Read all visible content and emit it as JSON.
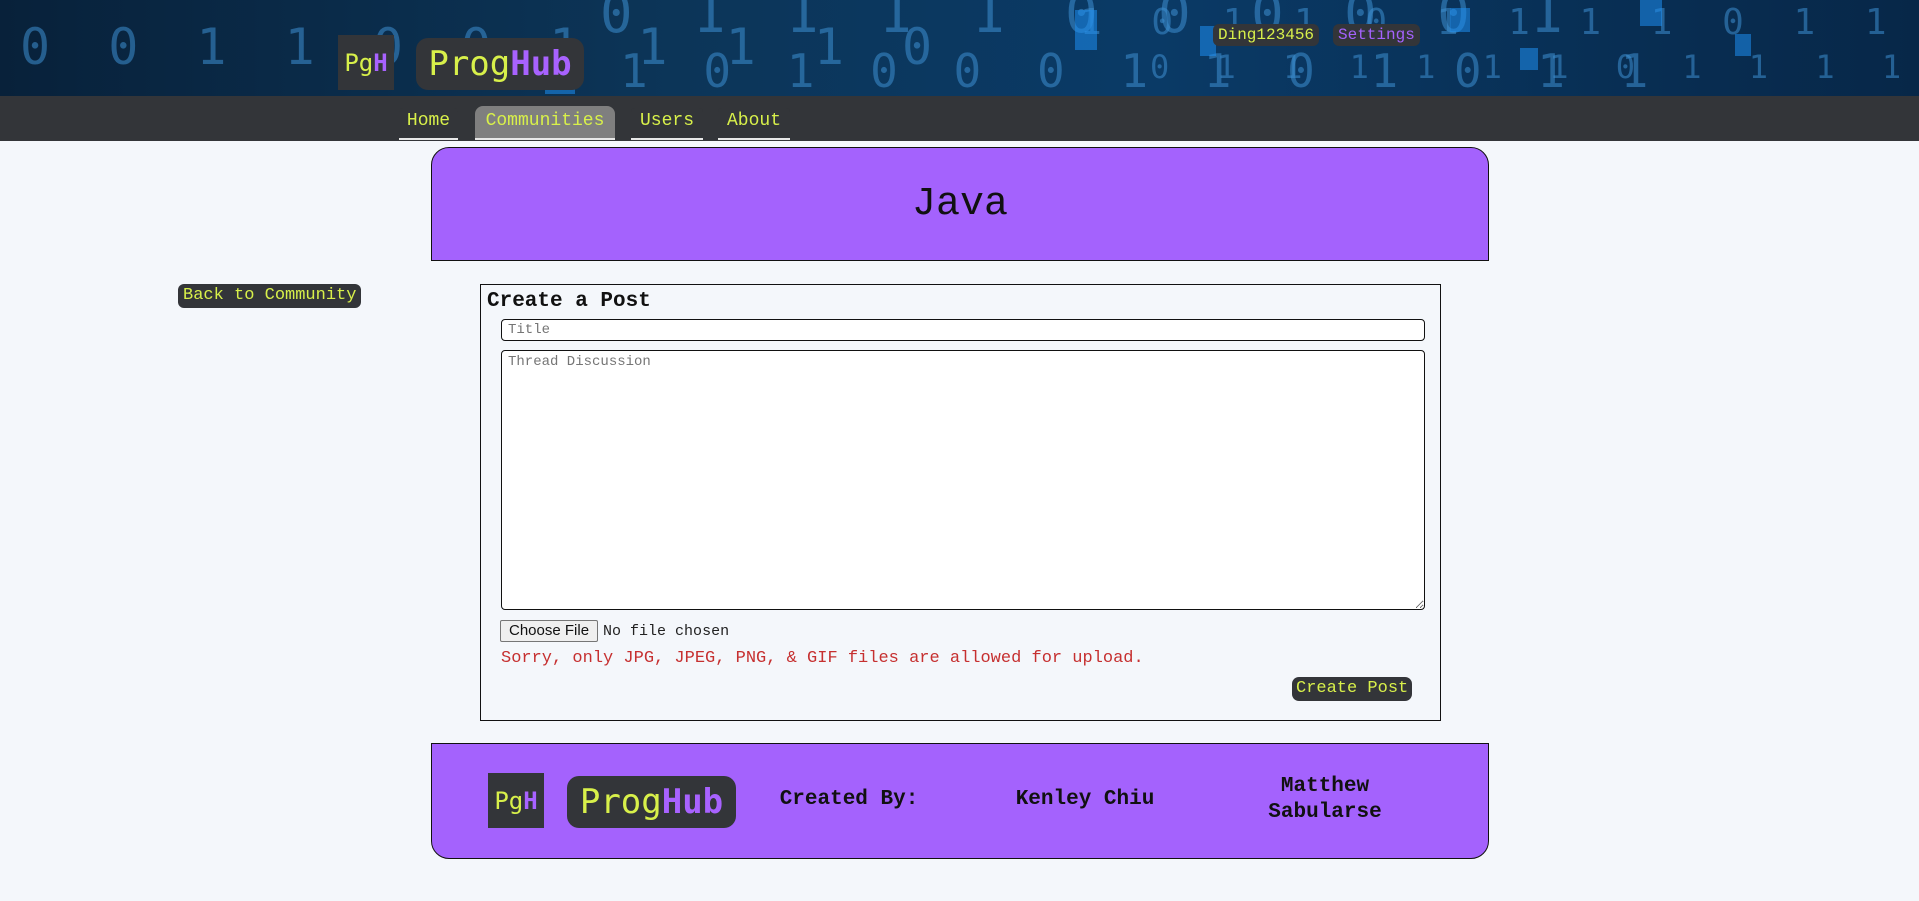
{
  "header": {
    "logo_mark": {
      "pg": "Pg",
      "h": "H"
    },
    "logo_wordmark": {
      "prog": "Prog",
      "hub": "Hub"
    },
    "username": "Ding123456",
    "settings_label": "Settings"
  },
  "nav": {
    "items": [
      {
        "label": "Home"
      },
      {
        "label": "Communities",
        "active": true
      },
      {
        "label": "Users"
      },
      {
        "label": "About"
      }
    ]
  },
  "community": {
    "title": "Java"
  },
  "back_label": "Back to Community",
  "post_form": {
    "heading": "Create a Post",
    "title_placeholder": "Title",
    "body_placeholder": "Thread Discussion",
    "choose_file_label": "Choose File",
    "file_status": "No file chosen",
    "file_error": "Sorry, only JPG, JPEG, PNG, & GIF files are allowed for upload.",
    "submit_label": "Create Post"
  },
  "footer": {
    "logo_mark": {
      "pg": "Pg",
      "h": "H"
    },
    "logo_wordmark": {
      "prog": "Prog",
      "hub": "Hub"
    },
    "created_by_label": "Created By:",
    "authors": [
      "Kenley Chiu",
      "Matthew Sabularse"
    ]
  },
  "colors": {
    "accent_purple": "#a462fd",
    "dark": "#333539",
    "lime": "#d8f04a",
    "error_red": "#c63030"
  }
}
